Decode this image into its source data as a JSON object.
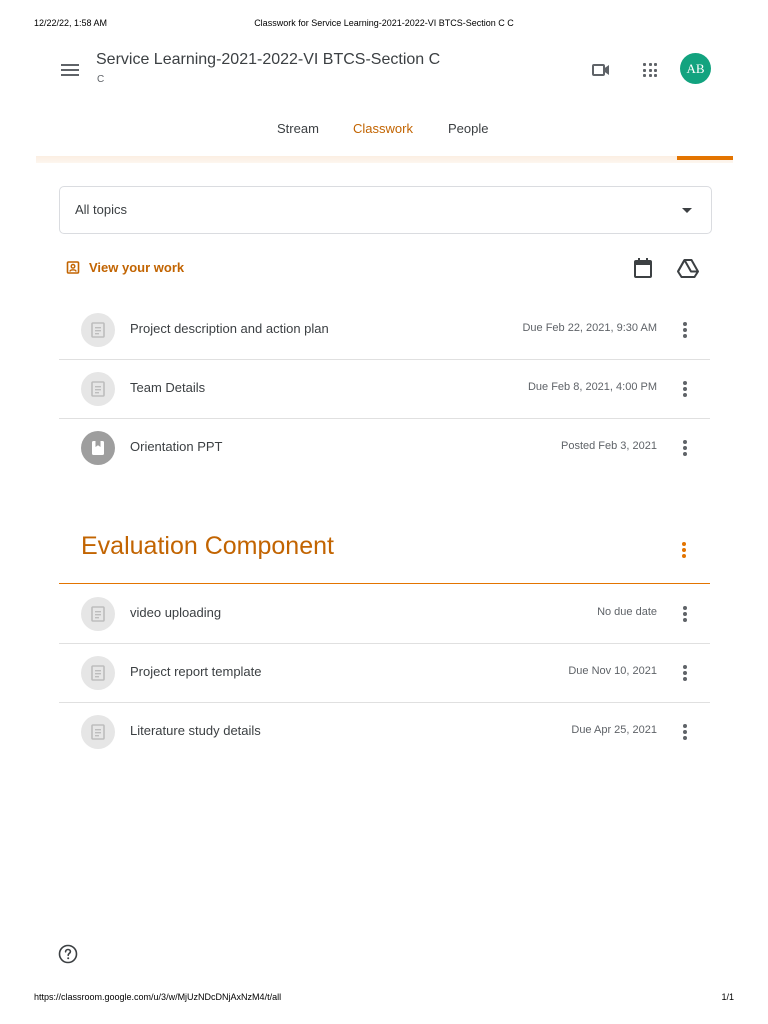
{
  "print_header": {
    "datetime": "12/22/22, 1:58 AM",
    "page_title": "Classwork for Service Learning-2021-2022-VI BTCS-Section C C"
  },
  "appbar": {
    "class_name": "Service Learning-2021-2022-VI BTCS-Section C",
    "section": "C",
    "avatar_initials": "AB",
    "avatar_color": "#12a37f",
    "icons": [
      "menu-icon",
      "video-camera-icon",
      "apps-grid-icon"
    ]
  },
  "tabs": [
    {
      "label": "Stream",
      "active": false
    },
    {
      "label": "Classwork",
      "active": true
    },
    {
      "label": "People",
      "active": false
    }
  ],
  "accent_color": "#c26401",
  "filter": {
    "selected": "All topics"
  },
  "toolbar": {
    "view_work_label": "View your work",
    "icons": [
      "calendar-icon",
      "google-drive-icon"
    ]
  },
  "items": [
    {
      "title": "Project description and action plan",
      "meta": "Due Feb 22, 2021, 9:30 AM",
      "icon": "assignment-icon"
    },
    {
      "title": "Team Details",
      "meta": "Due Feb 8, 2021, 4:00 PM",
      "icon": "assignment-icon"
    },
    {
      "title": "Orientation PPT",
      "meta": "Posted Feb 3, 2021",
      "icon": "material-icon"
    }
  ],
  "topics": [
    {
      "name": "Evaluation Component",
      "items": [
        {
          "title": "video uploading",
          "meta": "No due date",
          "icon": "assignment-icon"
        },
        {
          "title": "Project report template",
          "meta": "Due Nov 10, 2021",
          "icon": "assignment-icon"
        },
        {
          "title": "Literature study details",
          "meta": "Due Apr 25, 2021",
          "icon": "assignment-icon"
        }
      ]
    }
  ],
  "print_footer": {
    "url": "https://classroom.google.com/u/3/w/MjUzNDcDNjAxNzM4/t/all",
    "page": "1/1"
  }
}
